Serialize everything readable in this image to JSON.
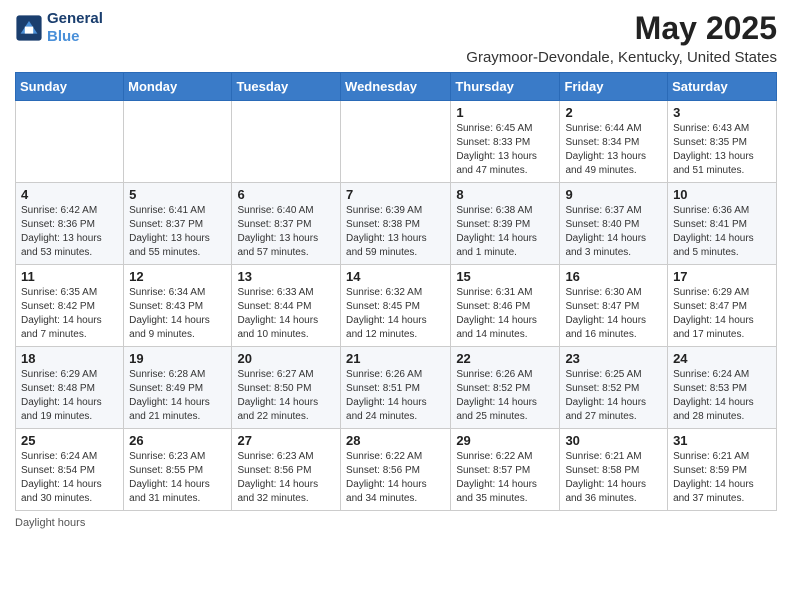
{
  "header": {
    "logo_line1": "General",
    "logo_line2": "Blue",
    "title": "May 2025",
    "subtitle": "Graymoor-Devondale, Kentucky, United States"
  },
  "days_of_week": [
    "Sunday",
    "Monday",
    "Tuesday",
    "Wednesday",
    "Thursday",
    "Friday",
    "Saturday"
  ],
  "weeks": [
    [
      {
        "day": "",
        "info": ""
      },
      {
        "day": "",
        "info": ""
      },
      {
        "day": "",
        "info": ""
      },
      {
        "day": "",
        "info": ""
      },
      {
        "day": "1",
        "info": "Sunrise: 6:45 AM\nSunset: 8:33 PM\nDaylight: 13 hours\nand 47 minutes."
      },
      {
        "day": "2",
        "info": "Sunrise: 6:44 AM\nSunset: 8:34 PM\nDaylight: 13 hours\nand 49 minutes."
      },
      {
        "day": "3",
        "info": "Sunrise: 6:43 AM\nSunset: 8:35 PM\nDaylight: 13 hours\nand 51 minutes."
      }
    ],
    [
      {
        "day": "4",
        "info": "Sunrise: 6:42 AM\nSunset: 8:36 PM\nDaylight: 13 hours\nand 53 minutes."
      },
      {
        "day": "5",
        "info": "Sunrise: 6:41 AM\nSunset: 8:37 PM\nDaylight: 13 hours\nand 55 minutes."
      },
      {
        "day": "6",
        "info": "Sunrise: 6:40 AM\nSunset: 8:37 PM\nDaylight: 13 hours\nand 57 minutes."
      },
      {
        "day": "7",
        "info": "Sunrise: 6:39 AM\nSunset: 8:38 PM\nDaylight: 13 hours\nand 59 minutes."
      },
      {
        "day": "8",
        "info": "Sunrise: 6:38 AM\nSunset: 8:39 PM\nDaylight: 14 hours\nand 1 minute."
      },
      {
        "day": "9",
        "info": "Sunrise: 6:37 AM\nSunset: 8:40 PM\nDaylight: 14 hours\nand 3 minutes."
      },
      {
        "day": "10",
        "info": "Sunrise: 6:36 AM\nSunset: 8:41 PM\nDaylight: 14 hours\nand 5 minutes."
      }
    ],
    [
      {
        "day": "11",
        "info": "Sunrise: 6:35 AM\nSunset: 8:42 PM\nDaylight: 14 hours\nand 7 minutes."
      },
      {
        "day": "12",
        "info": "Sunrise: 6:34 AM\nSunset: 8:43 PM\nDaylight: 14 hours\nand 9 minutes."
      },
      {
        "day": "13",
        "info": "Sunrise: 6:33 AM\nSunset: 8:44 PM\nDaylight: 14 hours\nand 10 minutes."
      },
      {
        "day": "14",
        "info": "Sunrise: 6:32 AM\nSunset: 8:45 PM\nDaylight: 14 hours\nand 12 minutes."
      },
      {
        "day": "15",
        "info": "Sunrise: 6:31 AM\nSunset: 8:46 PM\nDaylight: 14 hours\nand 14 minutes."
      },
      {
        "day": "16",
        "info": "Sunrise: 6:30 AM\nSunset: 8:47 PM\nDaylight: 14 hours\nand 16 minutes."
      },
      {
        "day": "17",
        "info": "Sunrise: 6:29 AM\nSunset: 8:47 PM\nDaylight: 14 hours\nand 17 minutes."
      }
    ],
    [
      {
        "day": "18",
        "info": "Sunrise: 6:29 AM\nSunset: 8:48 PM\nDaylight: 14 hours\nand 19 minutes."
      },
      {
        "day": "19",
        "info": "Sunrise: 6:28 AM\nSunset: 8:49 PM\nDaylight: 14 hours\nand 21 minutes."
      },
      {
        "day": "20",
        "info": "Sunrise: 6:27 AM\nSunset: 8:50 PM\nDaylight: 14 hours\nand 22 minutes."
      },
      {
        "day": "21",
        "info": "Sunrise: 6:26 AM\nSunset: 8:51 PM\nDaylight: 14 hours\nand 24 minutes."
      },
      {
        "day": "22",
        "info": "Sunrise: 6:26 AM\nSunset: 8:52 PM\nDaylight: 14 hours\nand 25 minutes."
      },
      {
        "day": "23",
        "info": "Sunrise: 6:25 AM\nSunset: 8:52 PM\nDaylight: 14 hours\nand 27 minutes."
      },
      {
        "day": "24",
        "info": "Sunrise: 6:24 AM\nSunset: 8:53 PM\nDaylight: 14 hours\nand 28 minutes."
      }
    ],
    [
      {
        "day": "25",
        "info": "Sunrise: 6:24 AM\nSunset: 8:54 PM\nDaylight: 14 hours\nand 30 minutes."
      },
      {
        "day": "26",
        "info": "Sunrise: 6:23 AM\nSunset: 8:55 PM\nDaylight: 14 hours\nand 31 minutes."
      },
      {
        "day": "27",
        "info": "Sunrise: 6:23 AM\nSunset: 8:56 PM\nDaylight: 14 hours\nand 32 minutes."
      },
      {
        "day": "28",
        "info": "Sunrise: 6:22 AM\nSunset: 8:56 PM\nDaylight: 14 hours\nand 34 minutes."
      },
      {
        "day": "29",
        "info": "Sunrise: 6:22 AM\nSunset: 8:57 PM\nDaylight: 14 hours\nand 35 minutes."
      },
      {
        "day": "30",
        "info": "Sunrise: 6:21 AM\nSunset: 8:58 PM\nDaylight: 14 hours\nand 36 minutes."
      },
      {
        "day": "31",
        "info": "Sunrise: 6:21 AM\nSunset: 8:59 PM\nDaylight: 14 hours\nand 37 minutes."
      }
    ]
  ],
  "footer": {
    "daylight_label": "Daylight hours"
  }
}
